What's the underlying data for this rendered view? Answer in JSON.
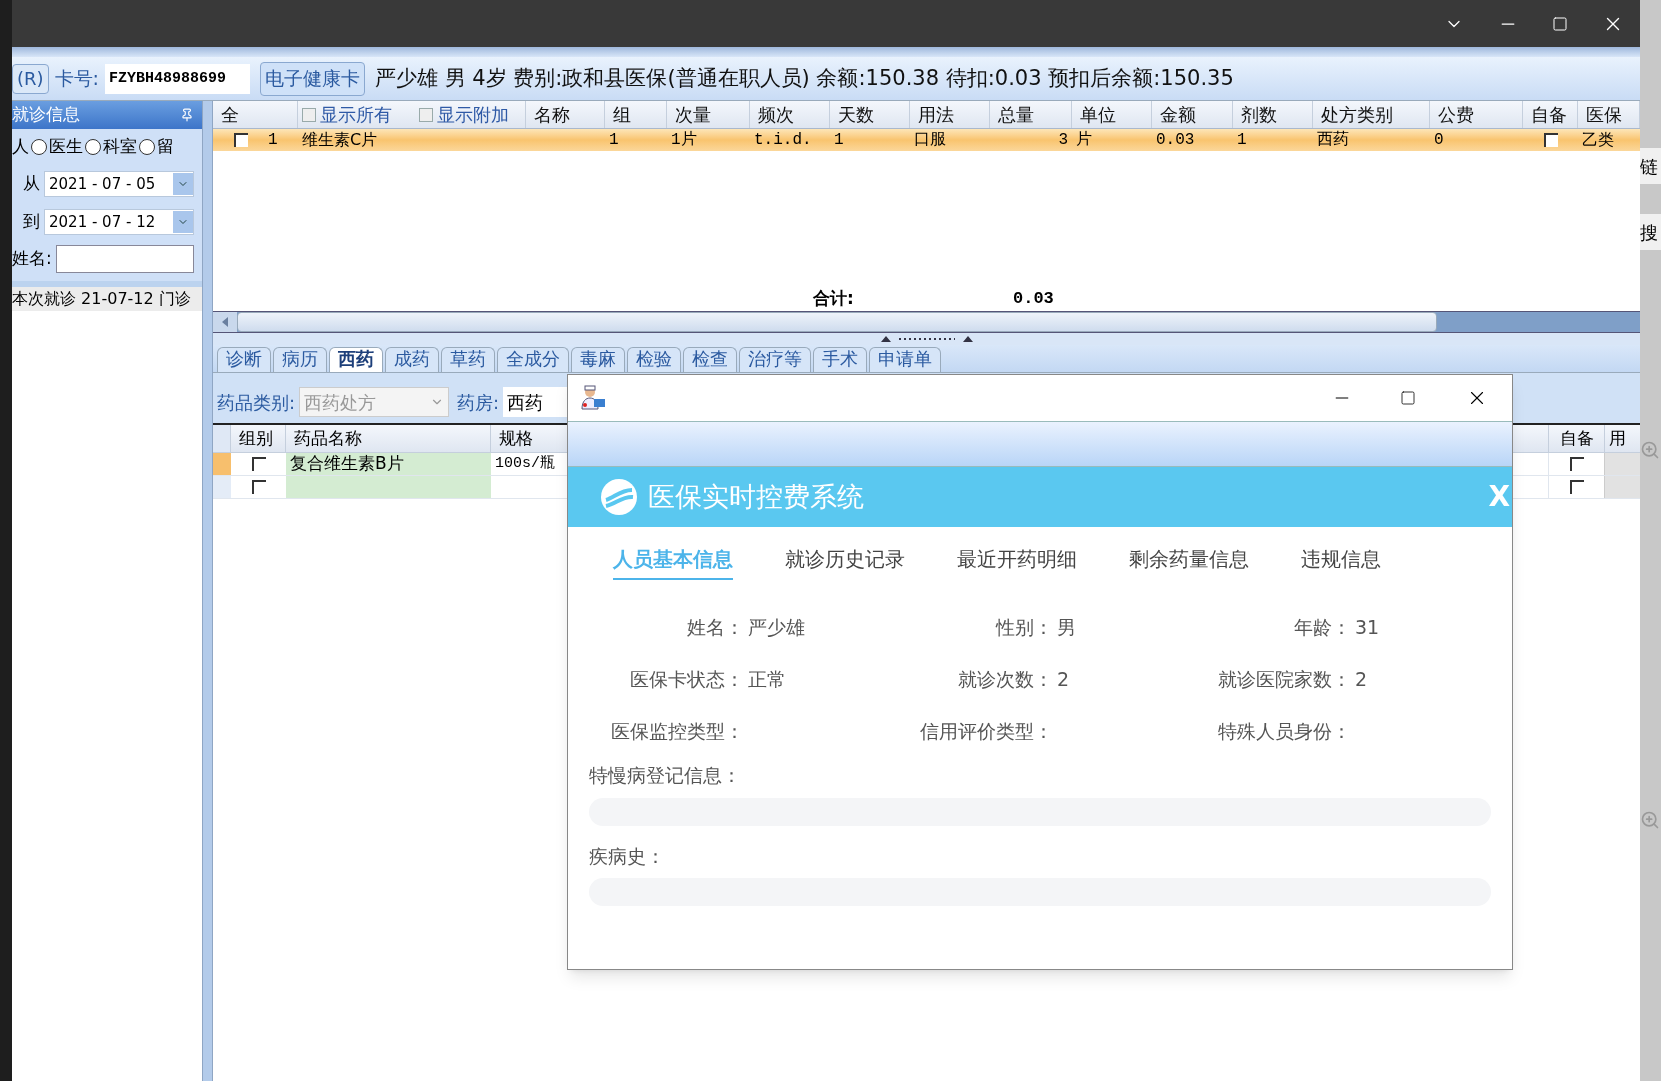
{
  "patient_bar": {
    "card_button": "(R)",
    "card_label": "卡号:",
    "card_number": "FZYBH48988699",
    "health_card_button": "电子健康卡",
    "info": "严少雄 男 4岁 费别:政和县医保(普通在职人员) 余额:150.38 待扣:0.03 预扣后余额:150.35"
  },
  "left_panel": {
    "title": "就诊信息",
    "filter_prefix": "人",
    "filters": [
      {
        "label": "医生",
        "selected": false
      },
      {
        "label": "科室",
        "selected": false
      },
      {
        "label": "留",
        "selected": false
      }
    ],
    "date_from": {
      "label": "从",
      "value": "2021 - 07 - 05"
    },
    "date_to": {
      "label": "到",
      "value": "2021 - 07 - 12"
    },
    "name_label": "姓名:",
    "visits": [
      {
        "text": "本次就诊 21-07-12 门诊",
        "selected": true
      }
    ]
  },
  "prescription_grid": {
    "header_options": [
      {
        "label": "显示所有",
        "checked": false
      },
      {
        "label": "显示附加",
        "checked": false
      }
    ],
    "columns": [
      "全",
      "名称",
      "组",
      "次量",
      "频次",
      "天数",
      "用法",
      "总量",
      "单位",
      "金额",
      "剂数",
      "处方类别",
      "公费",
      "自备",
      "医保"
    ],
    "rows": [
      {
        "checked": false,
        "selected": true,
        "self_supplied": false,
        "cells": [
          "1",
          "维生素C片",
          "1",
          "1片",
          "t.i.d.",
          "1",
          "口服",
          "3",
          "片",
          "0.03",
          "1",
          "西药",
          "0",
          "",
          "乙类"
        ]
      }
    ],
    "total_label": "合计:",
    "total_value": "0.03"
  },
  "tabs": [
    {
      "label": "诊断",
      "selected": false
    },
    {
      "label": "病历",
      "selected": false
    },
    {
      "label": "西药",
      "selected": true
    },
    {
      "label": "成药",
      "selected": false
    },
    {
      "label": "草药",
      "selected": false
    },
    {
      "label": "全成分",
      "selected": false
    },
    {
      "label": "毒麻",
      "selected": false
    },
    {
      "label": "检验",
      "selected": false
    },
    {
      "label": "检查",
      "selected": false
    },
    {
      "label": "治疗等",
      "selected": false
    },
    {
      "label": "手术",
      "selected": false
    },
    {
      "label": "申请单",
      "selected": false
    }
  ],
  "drug_toolbar": {
    "category_label": "药品类别:",
    "category_value": "西药处方",
    "pharmacy_label": "药房:",
    "pharmacy_value": "西药"
  },
  "drug_grid": {
    "columns_left": [
      "组别",
      "药品名称",
      "规格"
    ],
    "columns_right": [
      "自备",
      "用"
    ],
    "rows": [
      {
        "current": true,
        "group_checked": false,
        "name": "复合维生素B片",
        "spec": "100s/瓶",
        "self_checked": false
      },
      {
        "current": false,
        "group_checked": false,
        "self_checked": false
      }
    ]
  },
  "dialog": {
    "header_title": "医保实时控费系统",
    "header_close": "X",
    "tabs": [
      {
        "label": "人员基本信息",
        "selected": true
      },
      {
        "label": "就诊历史记录",
        "selected": false
      },
      {
        "label": "最近开药明细",
        "selected": false
      },
      {
        "label": "剩余药量信息",
        "selected": false
      },
      {
        "label": "违规信息",
        "selected": false
      }
    ],
    "fields": [
      {
        "label": "姓名：",
        "value": "严少雄"
      },
      {
        "label": "性别：",
        "value": "男"
      },
      {
        "label": "年龄：",
        "value": "31"
      },
      {
        "label": "医保卡状态：",
        "value": "正常"
      },
      {
        "label": "就诊次数：",
        "value": "2"
      },
      {
        "label": "就诊医院家数：",
        "value": "2"
      },
      {
        "label": "医保监控类型："
      },
      {
        "label": "信用评价类型："
      },
      {
        "label": "特殊人员身份："
      }
    ],
    "sections": [
      {
        "label": "特慢病登记信息："
      },
      {
        "label": "疾病史："
      }
    ]
  },
  "side_strip": {
    "texts": [
      "链",
      "搜"
    ]
  }
}
